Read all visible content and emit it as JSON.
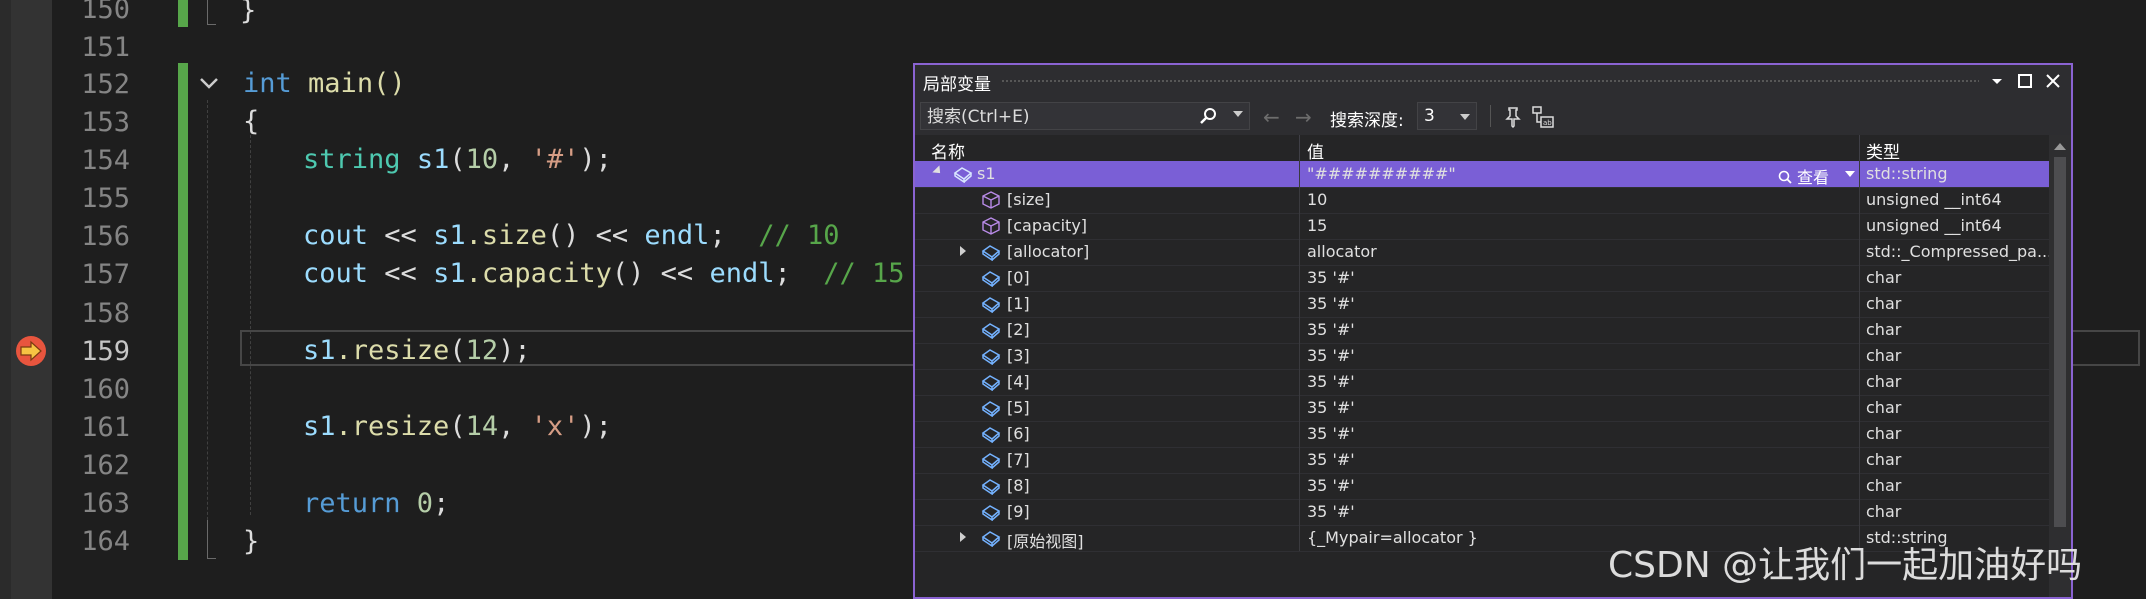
{
  "editor": {
    "line_numbers": [
      "150",
      "151",
      "152",
      "153",
      "154",
      "155",
      "156",
      "157",
      "158",
      "159",
      "160",
      "161",
      "162",
      "163",
      "164"
    ],
    "closing_brace_top": "}",
    "main_keyword": "int",
    "main_signature": "main()",
    "open_brace": "{",
    "close_brace": "}",
    "line154": {
      "type": "string",
      "var": "s1",
      "args_open": "(",
      "num": "10",
      "comma": ", ",
      "chr": "'#'",
      "end": ");"
    },
    "line156": {
      "cout": "cout",
      "op1": " << ",
      "var": "s1",
      "fn": ".size",
      "paren": "()",
      "op2": " << ",
      "endl": "endl",
      "semi": ";  ",
      "comment": "// 10"
    },
    "line157": {
      "cout": "cout",
      "op1": " << ",
      "var": "s1",
      "fn": ".capacity",
      "paren": "()",
      "op2": " << ",
      "endl": "endl",
      "semi": ";  ",
      "comment": "// 15"
    },
    "line159": {
      "var": "s1",
      "fn": ".resize",
      "open": "(",
      "num": "12",
      "end": ");"
    },
    "line161": {
      "var": "s1",
      "fn": ".resize",
      "open": "(",
      "num": "14",
      "comma": ", ",
      "chr": "'x'",
      "end": ");"
    },
    "line163": {
      "kw": "return",
      "num": " 0",
      "end": ";"
    },
    "colors": {
      "keyword": "#569cd6",
      "type": "#4ec9b0",
      "function": "#dcdcaa",
      "variable": "#9cdcfe",
      "number": "#b5cea8",
      "string": "#d69d85",
      "comment": "#57a64a",
      "change_bar": "#57a64a",
      "breakpoint": "#e8553e",
      "accent": "#8a63d2"
    }
  },
  "locals": {
    "title": "局部变量",
    "search_placeholder": "搜索(Ctrl+E)",
    "depth_label": "搜索深度:",
    "depth_value": "3",
    "columns": {
      "name": "名称",
      "value": "值",
      "type": "类型"
    },
    "view_label": "查看",
    "rows": [
      {
        "name": "s1",
        "value": "\"##########\"",
        "type": "std::string",
        "selected": true,
        "expander": "down",
        "indent": 0
      },
      {
        "name": "[size]",
        "value": "10",
        "type": "unsigned __int64",
        "expander": "",
        "indent": 1,
        "icon": "field"
      },
      {
        "name": "[capacity]",
        "value": "15",
        "type": "unsigned __int64",
        "expander": "",
        "indent": 1,
        "icon": "field"
      },
      {
        "name": "[allocator]",
        "value": "allocator",
        "type": "std::_Compressed_pa...",
        "expander": "right",
        "indent": 1
      },
      {
        "name": "[0]",
        "value": "35 '#'",
        "type": "char",
        "expander": "",
        "indent": 1
      },
      {
        "name": "[1]",
        "value": "35 '#'",
        "type": "char",
        "expander": "",
        "indent": 1
      },
      {
        "name": "[2]",
        "value": "35 '#'",
        "type": "char",
        "expander": "",
        "indent": 1
      },
      {
        "name": "[3]",
        "value": "35 '#'",
        "type": "char",
        "expander": "",
        "indent": 1
      },
      {
        "name": "[4]",
        "value": "35 '#'",
        "type": "char",
        "expander": "",
        "indent": 1
      },
      {
        "name": "[5]",
        "value": "35 '#'",
        "type": "char",
        "expander": "",
        "indent": 1
      },
      {
        "name": "[6]",
        "value": "35 '#'",
        "type": "char",
        "expander": "",
        "indent": 1
      },
      {
        "name": "[7]",
        "value": "35 '#'",
        "type": "char",
        "expander": "",
        "indent": 1
      },
      {
        "name": "[8]",
        "value": "35 '#'",
        "type": "char",
        "expander": "",
        "indent": 1
      },
      {
        "name": "[9]",
        "value": "35 '#'",
        "type": "char",
        "expander": "",
        "indent": 1
      },
      {
        "name": "[原始视图]",
        "value": "{_Mypair=allocator }",
        "type": "std::string",
        "expander": "right",
        "indent": 1
      }
    ]
  },
  "watermark": "CSDN @让我们一起加油好吗"
}
